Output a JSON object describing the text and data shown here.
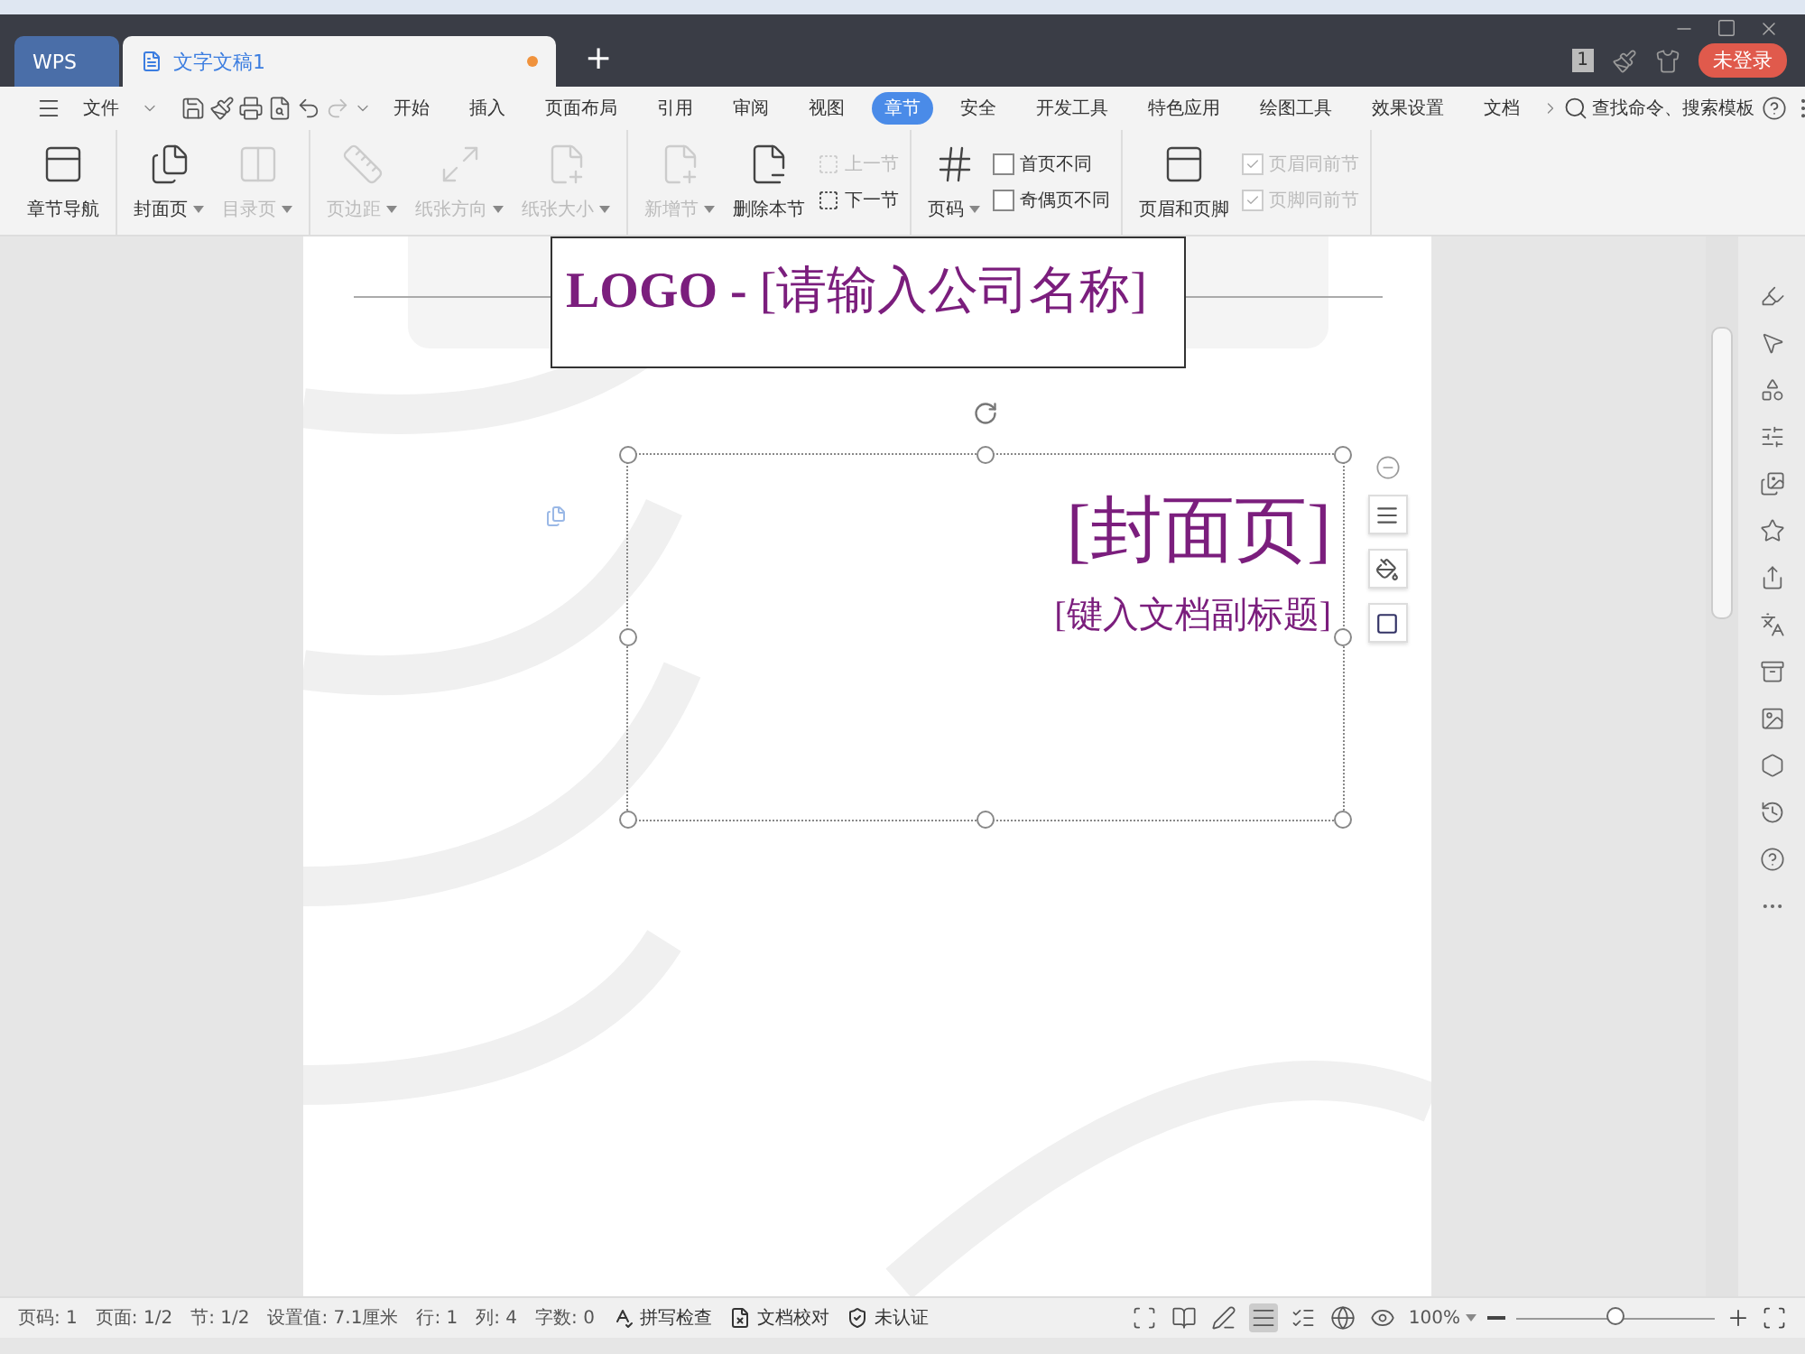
{
  "tabs": [
    {
      "label": "WPS",
      "kind": "home",
      "selected": false
    },
    {
      "label": "文字文稿1",
      "kind": "doc",
      "selected": true,
      "modified": true
    }
  ],
  "new_tab": "+",
  "title_bar": {
    "badge": "1",
    "login": "未登录"
  },
  "menu": {
    "file": "文件",
    "tabs": [
      {
        "label": "开始",
        "selected": false
      },
      {
        "label": "插入",
        "selected": false
      },
      {
        "label": "页面布局",
        "selected": false
      },
      {
        "label": "引用",
        "selected": false
      },
      {
        "label": "审阅",
        "selected": false
      },
      {
        "label": "视图",
        "selected": false
      },
      {
        "label": "章节",
        "selected": true
      },
      {
        "label": "安全",
        "selected": false
      },
      {
        "label": "开发工具",
        "selected": false
      },
      {
        "label": "特色应用",
        "selected": false
      },
      {
        "label": "绘图工具",
        "selected": false
      },
      {
        "label": "效果设置",
        "selected": false
      },
      {
        "label": "文档",
        "selected": false
      }
    ],
    "search": "查找命令、搜索模板"
  },
  "ribbon": [
    {
      "items": [
        {
          "kind": "big",
          "label": "章节导航",
          "disabled": false,
          "dropdown": false
        }
      ]
    },
    {
      "items": [
        {
          "kind": "big",
          "label": "封面页",
          "disabled": false,
          "dropdown": true
        },
        {
          "kind": "big",
          "label": "目录页",
          "disabled": true,
          "dropdown": true
        }
      ]
    },
    {
      "items": [
        {
          "kind": "big",
          "label": "页边距",
          "disabled": true,
          "dropdown": true
        },
        {
          "kind": "big",
          "label": "纸张方向",
          "disabled": true,
          "dropdown": true
        },
        {
          "kind": "big",
          "label": "纸张大小",
          "disabled": true,
          "dropdown": true
        }
      ]
    },
    {
      "items": [
        {
          "kind": "big",
          "label": "新增节",
          "disabled": true,
          "dropdown": true
        },
        {
          "kind": "big",
          "label": "删除本节",
          "disabled": false,
          "dropdown": false
        },
        {
          "kind": "small",
          "label": "上一节",
          "disabled": true
        },
        {
          "kind": "small",
          "label": "下一节",
          "disabled": false
        }
      ]
    },
    {
      "items": [
        {
          "kind": "big",
          "label": "页码",
          "disabled": false,
          "dropdown": true
        },
        {
          "kind": "check",
          "label": "首页不同",
          "checked": false,
          "disabled": false
        },
        {
          "kind": "check",
          "label": "奇偶页不同",
          "checked": false,
          "disabled": false
        }
      ]
    },
    {
      "items": [
        {
          "kind": "big",
          "label": "页眉和页脚",
          "disabled": false,
          "dropdown": false
        },
        {
          "kind": "check",
          "label": "页眉同前节",
          "checked": true,
          "disabled": true
        },
        {
          "kind": "check",
          "label": "页脚同前节",
          "checked": true,
          "disabled": true
        }
      ]
    }
  ],
  "document": {
    "logo": "LOGO -",
    "company": "[请输入公司名称]",
    "title": "[封面页]",
    "subtitle": "[键入文档副标题]"
  },
  "status_bar": {
    "items": [
      {
        "kind": "text",
        "label": "页码: 1"
      },
      {
        "kind": "text",
        "label": "页面: 1/2"
      },
      {
        "kind": "text",
        "label": "节: 1/2"
      },
      {
        "kind": "text",
        "label": "设置值: 7.1厘米"
      },
      {
        "kind": "text",
        "label": "行: 1"
      },
      {
        "kind": "text",
        "label": "列: 4"
      },
      {
        "kind": "text",
        "label": "字数: 0"
      },
      {
        "kind": "spell",
        "label": "拼写检查"
      },
      {
        "kind": "proof",
        "label": "文档校对"
      },
      {
        "kind": "cert",
        "label": "未认证"
      }
    ],
    "views": [
      {
        "selected": false
      },
      {
        "selected": false
      },
      {
        "selected": false
      },
      {
        "selected": true
      },
      {
        "selected": false
      },
      {
        "selected": false
      },
      {
        "selected": false
      }
    ],
    "zoom": "100%",
    "level": 0.5
  }
}
